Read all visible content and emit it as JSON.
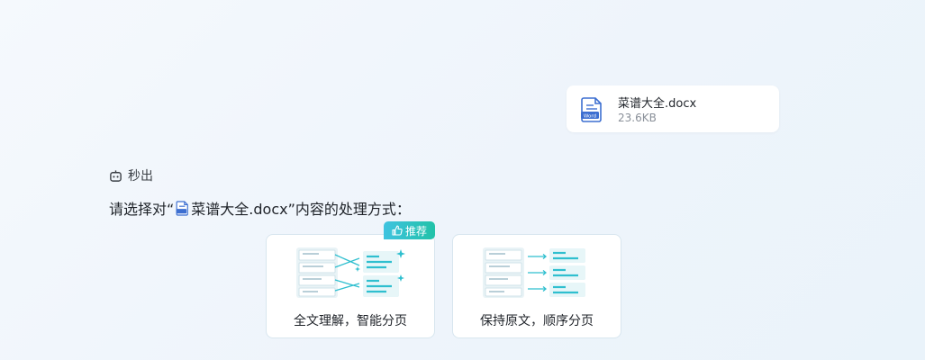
{
  "file": {
    "name": "菜谱大全.docx",
    "size": "23.6KB",
    "icon": "word-doc-icon"
  },
  "bot": {
    "icon": "robot-icon",
    "status": "秒出"
  },
  "prompt": {
    "prefix": "请选择对“",
    "filename": "菜谱大全.docx",
    "suffix": "”内容的处理方式："
  },
  "badge": {
    "label": "推荐",
    "icon": "thumbs-up-icon"
  },
  "options": [
    {
      "label": "全文理解，智能分页",
      "recommended": true
    },
    {
      "label": "保持原文，顺序分页",
      "recommended": false
    }
  ],
  "colors": {
    "accent": "#2fbfcf",
    "badge_start": "#3fc3e0",
    "badge_end": "#21c2a8"
  }
}
